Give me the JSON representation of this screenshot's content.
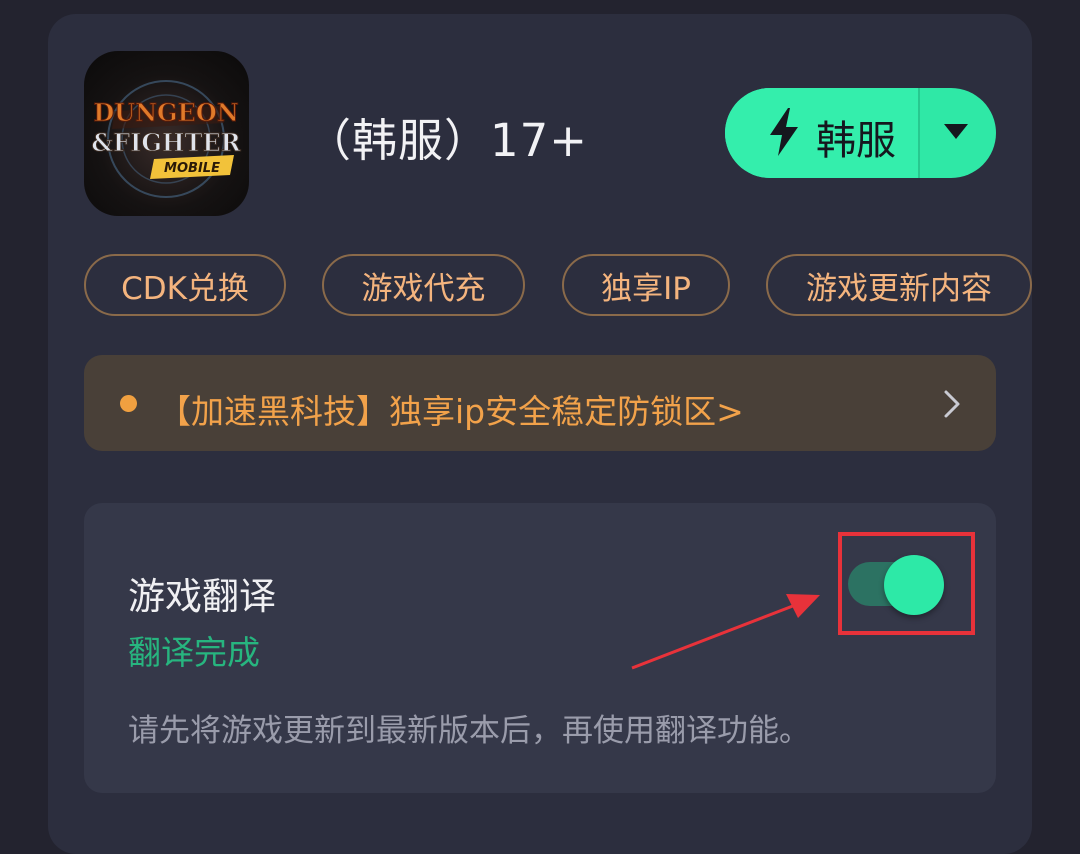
{
  "app": {
    "title": "（韩服）17+",
    "icon_name": "dungeon-fighter-mobile-logo",
    "icon_logo_text": [
      "DUNGEON",
      "&FIGHTER",
      "MOBILE"
    ]
  },
  "region_selector": {
    "label": "韩服",
    "icon": "bolt-icon",
    "dropdown_icon": "caret-down-icon",
    "color": "#34eeac"
  },
  "tags": [
    {
      "label": "CDK兑换"
    },
    {
      "label": "游戏代充"
    },
    {
      "label": "独享IP"
    },
    {
      "label": "游戏更新内容"
    }
  ],
  "promo": {
    "text": "【加速黑科技】独享ip安全稳定防锁区>",
    "color": "#f2a24a"
  },
  "translation": {
    "title": "游戏翻译",
    "status": "翻译完成",
    "status_color": "#27b57f",
    "note": "请先将游戏更新到最新版本后，再使用翻译功能。",
    "enabled": true,
    "toggle_color": "#2de9a7"
  },
  "annotation": {
    "highlight_color": "#e8323a"
  }
}
